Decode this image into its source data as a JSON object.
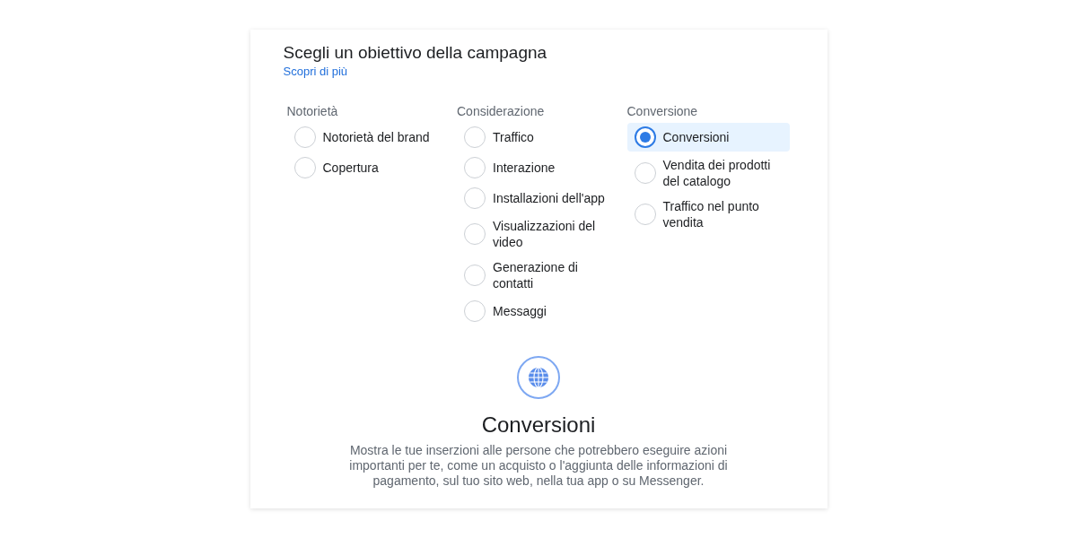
{
  "title": "Scegli un obiettivo della campagna",
  "learn_more_link": "Scopri di più",
  "categories": [
    {
      "heading": "Notorietà",
      "options": [
        {
          "label": "Notorietà del brand",
          "selected": false
        },
        {
          "label": "Copertura",
          "selected": false
        }
      ]
    },
    {
      "heading": "Considerazione",
      "options": [
        {
          "label": "Traffico",
          "selected": false
        },
        {
          "label": "Interazione",
          "selected": false
        },
        {
          "label": "Installazioni dell'app",
          "selected": false
        },
        {
          "label": "Visualizzazioni del video",
          "selected": false
        },
        {
          "label": "Generazione di contatti",
          "selected": false
        },
        {
          "label": "Messaggi",
          "selected": false
        }
      ]
    },
    {
      "heading": "Conversione",
      "options": [
        {
          "label": "Conversioni",
          "selected": true
        },
        {
          "label": "Vendita dei prodotti del catalogo",
          "selected": false
        },
        {
          "label": "Traffico nel punto vendita",
          "selected": false
        }
      ]
    }
  ],
  "detail": {
    "title": "Conversioni",
    "description": "Mostra le tue inserzioni alle persone che potrebbero eseguire azioni importanti per te, come un acquisto o l'aggiunta delle informazioni di pagamento, sul tuo sito web, nella tua app o su Messenger."
  }
}
